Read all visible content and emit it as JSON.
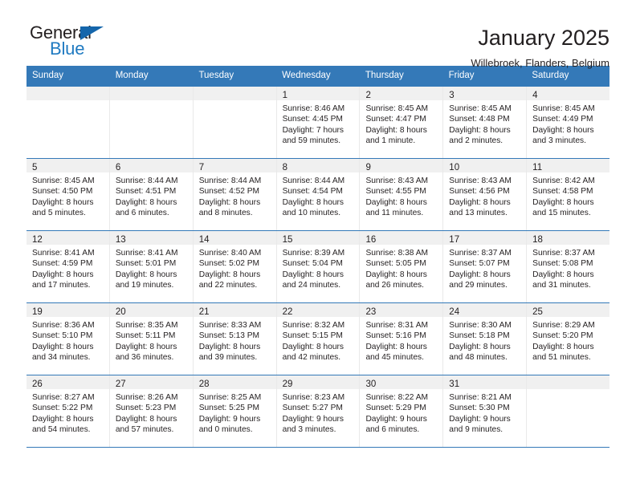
{
  "logo": {
    "primary": "General",
    "secondary": "Blue",
    "triangle_color": "#1566ab",
    "blue_color": "#1f7ac1"
  },
  "header": {
    "month_title": "January 2025",
    "location": "Willebroek, Flanders, Belgium"
  },
  "theme": {
    "header_blue": "#3479b8",
    "band_gray": "#f0f0f0",
    "text": "#231f20"
  },
  "weekdays": [
    "Sunday",
    "Monday",
    "Tuesday",
    "Wednesday",
    "Thursday",
    "Friday",
    "Saturday"
  ],
  "weeks": [
    [
      {
        "day": "",
        "sunrise": "",
        "sunset": "",
        "daylight1": "",
        "daylight2": ""
      },
      {
        "day": "",
        "sunrise": "",
        "sunset": "",
        "daylight1": "",
        "daylight2": ""
      },
      {
        "day": "",
        "sunrise": "",
        "sunset": "",
        "daylight1": "",
        "daylight2": ""
      },
      {
        "day": "1",
        "sunrise": "Sunrise: 8:46 AM",
        "sunset": "Sunset: 4:45 PM",
        "daylight1": "Daylight: 7 hours",
        "daylight2": "and 59 minutes."
      },
      {
        "day": "2",
        "sunrise": "Sunrise: 8:45 AM",
        "sunset": "Sunset: 4:47 PM",
        "daylight1": "Daylight: 8 hours",
        "daylight2": "and 1 minute."
      },
      {
        "day": "3",
        "sunrise": "Sunrise: 8:45 AM",
        "sunset": "Sunset: 4:48 PM",
        "daylight1": "Daylight: 8 hours",
        "daylight2": "and 2 minutes."
      },
      {
        "day": "4",
        "sunrise": "Sunrise: 8:45 AM",
        "sunset": "Sunset: 4:49 PM",
        "daylight1": "Daylight: 8 hours",
        "daylight2": "and 3 minutes."
      }
    ],
    [
      {
        "day": "5",
        "sunrise": "Sunrise: 8:45 AM",
        "sunset": "Sunset: 4:50 PM",
        "daylight1": "Daylight: 8 hours",
        "daylight2": "and 5 minutes."
      },
      {
        "day": "6",
        "sunrise": "Sunrise: 8:44 AM",
        "sunset": "Sunset: 4:51 PM",
        "daylight1": "Daylight: 8 hours",
        "daylight2": "and 6 minutes."
      },
      {
        "day": "7",
        "sunrise": "Sunrise: 8:44 AM",
        "sunset": "Sunset: 4:52 PM",
        "daylight1": "Daylight: 8 hours",
        "daylight2": "and 8 minutes."
      },
      {
        "day": "8",
        "sunrise": "Sunrise: 8:44 AM",
        "sunset": "Sunset: 4:54 PM",
        "daylight1": "Daylight: 8 hours",
        "daylight2": "and 10 minutes."
      },
      {
        "day": "9",
        "sunrise": "Sunrise: 8:43 AM",
        "sunset": "Sunset: 4:55 PM",
        "daylight1": "Daylight: 8 hours",
        "daylight2": "and 11 minutes."
      },
      {
        "day": "10",
        "sunrise": "Sunrise: 8:43 AM",
        "sunset": "Sunset: 4:56 PM",
        "daylight1": "Daylight: 8 hours",
        "daylight2": "and 13 minutes."
      },
      {
        "day": "11",
        "sunrise": "Sunrise: 8:42 AM",
        "sunset": "Sunset: 4:58 PM",
        "daylight1": "Daylight: 8 hours",
        "daylight2": "and 15 minutes."
      }
    ],
    [
      {
        "day": "12",
        "sunrise": "Sunrise: 8:41 AM",
        "sunset": "Sunset: 4:59 PM",
        "daylight1": "Daylight: 8 hours",
        "daylight2": "and 17 minutes."
      },
      {
        "day": "13",
        "sunrise": "Sunrise: 8:41 AM",
        "sunset": "Sunset: 5:01 PM",
        "daylight1": "Daylight: 8 hours",
        "daylight2": "and 19 minutes."
      },
      {
        "day": "14",
        "sunrise": "Sunrise: 8:40 AM",
        "sunset": "Sunset: 5:02 PM",
        "daylight1": "Daylight: 8 hours",
        "daylight2": "and 22 minutes."
      },
      {
        "day": "15",
        "sunrise": "Sunrise: 8:39 AM",
        "sunset": "Sunset: 5:04 PM",
        "daylight1": "Daylight: 8 hours",
        "daylight2": "and 24 minutes."
      },
      {
        "day": "16",
        "sunrise": "Sunrise: 8:38 AM",
        "sunset": "Sunset: 5:05 PM",
        "daylight1": "Daylight: 8 hours",
        "daylight2": "and 26 minutes."
      },
      {
        "day": "17",
        "sunrise": "Sunrise: 8:37 AM",
        "sunset": "Sunset: 5:07 PM",
        "daylight1": "Daylight: 8 hours",
        "daylight2": "and 29 minutes."
      },
      {
        "day": "18",
        "sunrise": "Sunrise: 8:37 AM",
        "sunset": "Sunset: 5:08 PM",
        "daylight1": "Daylight: 8 hours",
        "daylight2": "and 31 minutes."
      }
    ],
    [
      {
        "day": "19",
        "sunrise": "Sunrise: 8:36 AM",
        "sunset": "Sunset: 5:10 PM",
        "daylight1": "Daylight: 8 hours",
        "daylight2": "and 34 minutes."
      },
      {
        "day": "20",
        "sunrise": "Sunrise: 8:35 AM",
        "sunset": "Sunset: 5:11 PM",
        "daylight1": "Daylight: 8 hours",
        "daylight2": "and 36 minutes."
      },
      {
        "day": "21",
        "sunrise": "Sunrise: 8:33 AM",
        "sunset": "Sunset: 5:13 PM",
        "daylight1": "Daylight: 8 hours",
        "daylight2": "and 39 minutes."
      },
      {
        "day": "22",
        "sunrise": "Sunrise: 8:32 AM",
        "sunset": "Sunset: 5:15 PM",
        "daylight1": "Daylight: 8 hours",
        "daylight2": "and 42 minutes."
      },
      {
        "day": "23",
        "sunrise": "Sunrise: 8:31 AM",
        "sunset": "Sunset: 5:16 PM",
        "daylight1": "Daylight: 8 hours",
        "daylight2": "and 45 minutes."
      },
      {
        "day": "24",
        "sunrise": "Sunrise: 8:30 AM",
        "sunset": "Sunset: 5:18 PM",
        "daylight1": "Daylight: 8 hours",
        "daylight2": "and 48 minutes."
      },
      {
        "day": "25",
        "sunrise": "Sunrise: 8:29 AM",
        "sunset": "Sunset: 5:20 PM",
        "daylight1": "Daylight: 8 hours",
        "daylight2": "and 51 minutes."
      }
    ],
    [
      {
        "day": "26",
        "sunrise": "Sunrise: 8:27 AM",
        "sunset": "Sunset: 5:22 PM",
        "daylight1": "Daylight: 8 hours",
        "daylight2": "and 54 minutes."
      },
      {
        "day": "27",
        "sunrise": "Sunrise: 8:26 AM",
        "sunset": "Sunset: 5:23 PM",
        "daylight1": "Daylight: 8 hours",
        "daylight2": "and 57 minutes."
      },
      {
        "day": "28",
        "sunrise": "Sunrise: 8:25 AM",
        "sunset": "Sunset: 5:25 PM",
        "daylight1": "Daylight: 9 hours",
        "daylight2": "and 0 minutes."
      },
      {
        "day": "29",
        "sunrise": "Sunrise: 8:23 AM",
        "sunset": "Sunset: 5:27 PM",
        "daylight1": "Daylight: 9 hours",
        "daylight2": "and 3 minutes."
      },
      {
        "day": "30",
        "sunrise": "Sunrise: 8:22 AM",
        "sunset": "Sunset: 5:29 PM",
        "daylight1": "Daylight: 9 hours",
        "daylight2": "and 6 minutes."
      },
      {
        "day": "31",
        "sunrise": "Sunrise: 8:21 AM",
        "sunset": "Sunset: 5:30 PM",
        "daylight1": "Daylight: 9 hours",
        "daylight2": "and 9 minutes."
      },
      {
        "day": "",
        "sunrise": "",
        "sunset": "",
        "daylight1": "",
        "daylight2": ""
      }
    ]
  ]
}
